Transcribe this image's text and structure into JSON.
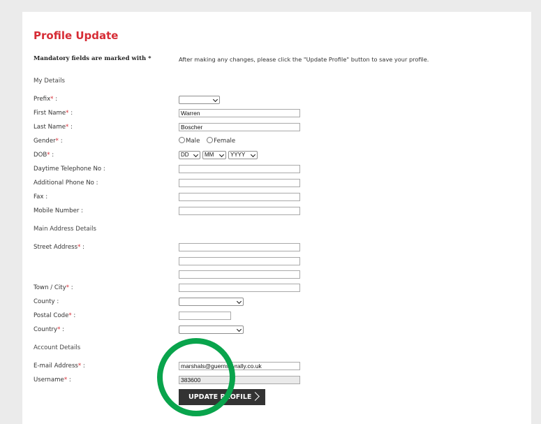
{
  "page": {
    "title": "Profile Update",
    "mandatory_note": "Mandatory fields are marked with *",
    "instructions": "After making any changes, please click the \"Update Profile\" button to save your profile."
  },
  "sections": {
    "my_details": "My Details",
    "main_address": "Main Address Details",
    "account": "Account Details"
  },
  "required_marker": "*",
  "labels": {
    "prefix": "Prefix",
    "first_name": "First Name",
    "last_name": "Last Name",
    "gender": "Gender",
    "dob": "DOB",
    "daytime_phone": "Daytime Telephone No :",
    "additional_phone": "Additional Phone No :",
    "fax": "Fax :",
    "mobile": "Mobile Number :",
    "street_address": "Street Address",
    "town_city": "Town / City",
    "county": "County :",
    "postal_code": "Postal Code",
    "country": "Country",
    "email": "E-mail Address",
    "username": "Username"
  },
  "values": {
    "prefix": "",
    "first_name": "Warren",
    "last_name": "Boscher",
    "gender_options": [
      "Male",
      "Female"
    ],
    "dob_day": "DD",
    "dob_month": "MM",
    "dob_year": "YYYY",
    "daytime_phone": "",
    "additional_phone": "",
    "fax": "",
    "mobile": "",
    "street_line1": "",
    "street_line2": "",
    "street_line3": "",
    "town_city": "",
    "county": "",
    "postal_code": "",
    "country": "",
    "email": "marshals@guernseyrally.co.uk",
    "username": "383600"
  },
  "button": {
    "update_label": "UPDATE PROFILE"
  },
  "colors": {
    "accent": "#d62c35",
    "button": "#333333",
    "highlight": "#09a44c"
  },
  "icons": {
    "dropdown": "chevron-down-icon",
    "button_arrow": "chevron-right-icon",
    "highlight": "circle-annotation"
  }
}
